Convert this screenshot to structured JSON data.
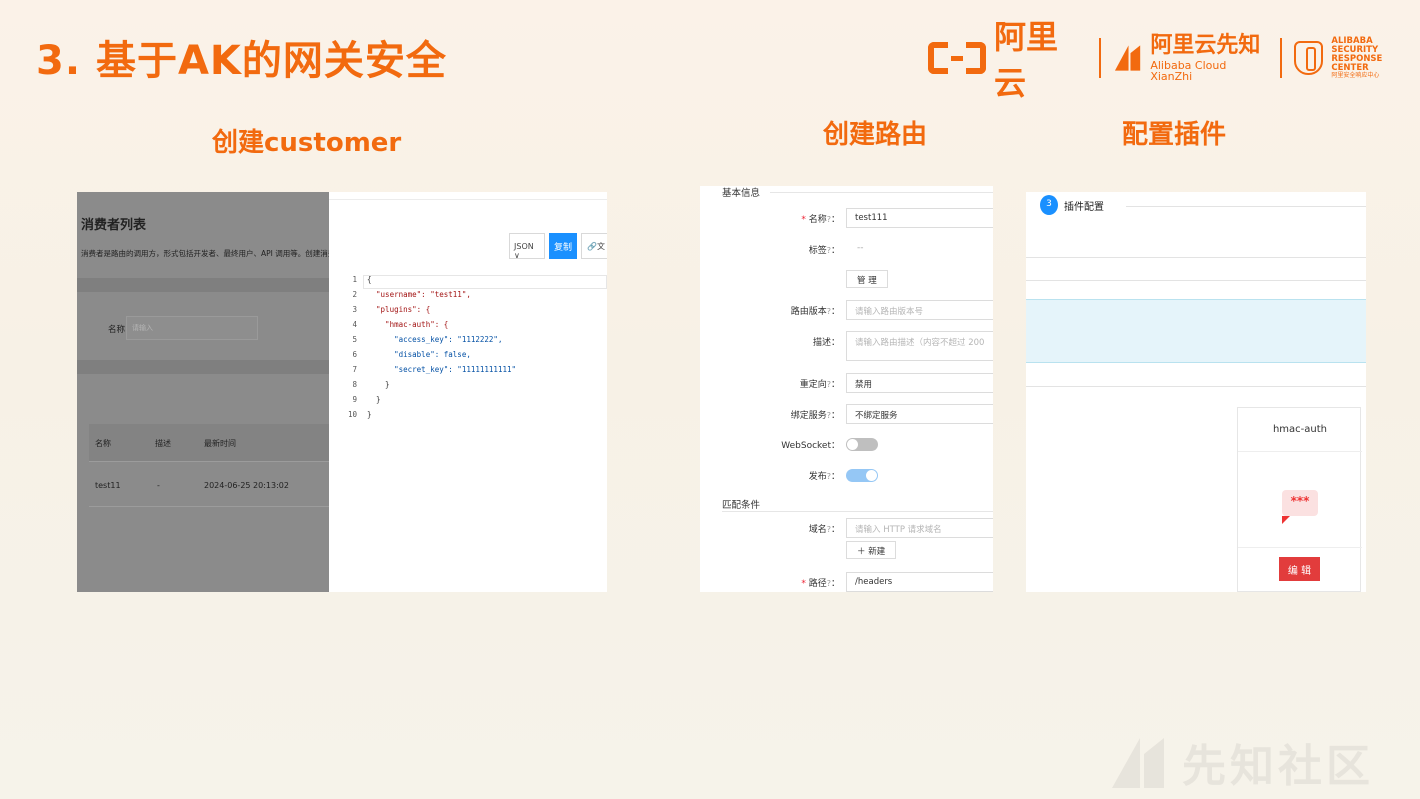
{
  "slide": {
    "title": "3. 基于AK的网关安全"
  },
  "logos": {
    "aliyun": "阿里云",
    "xianzhi_cn": "阿里云先知",
    "xianzhi_en": "Alibaba Cloud XianZhi",
    "asrc_line1": "ALIBABA SECURITY",
    "asrc_line2": "RESPONSE CENTER",
    "asrc_line3": "阿里安全响应中心"
  },
  "headings": {
    "customer": "创建customer",
    "route": "创建路由",
    "plugin": "配置插件"
  },
  "consumer_panel": {
    "title": "消费者列表",
    "description": "消费者是路由的调用方，形式包括开发者、最终用户、API 调用等。创建消费者时，需绑定至",
    "name_label": "名称:",
    "name_placeholder": "请输入",
    "columns": [
      "名称",
      "描述",
      "最新时间"
    ],
    "row": [
      "test11",
      "-",
      "2024-06-25 20:13:02"
    ],
    "format_select": "JSON",
    "copy_button": "复制",
    "doc_button": "文",
    "code_lines": [
      {
        "n": "1",
        "t": "{"
      },
      {
        "n": "2",
        "t": "  \"username\": \"test11\","
      },
      {
        "n": "3",
        "t": "  \"plugins\": {"
      },
      {
        "n": "4",
        "t": "    \"hmac-auth\": {"
      },
      {
        "n": "5",
        "t": "      \"access_key\": \"1112222\","
      },
      {
        "n": "6",
        "t": "      \"disable\": false,"
      },
      {
        "n": "7",
        "t": "      \"secret_key\": \"11111111111\""
      },
      {
        "n": "8",
        "t": "    }"
      },
      {
        "n": "9",
        "t": "  }"
      },
      {
        "n": "10",
        "t": "}"
      }
    ]
  },
  "route_panel": {
    "section_basic": "基本信息",
    "name_label": "名称",
    "name_value": "test111",
    "tags_label": "标签",
    "tags_value": "--",
    "manage_button": "管 理",
    "version_label": "路由版本",
    "version_placeholder": "请输入路由版本号",
    "desc_label": "描述",
    "desc_placeholder": "请输入路由描述（内容不超过 200",
    "redirect_label": "重定向",
    "redirect_value": "禁用",
    "service_label": "绑定服务",
    "service_value": "不绑定服务",
    "websocket_label": "WebSocket",
    "publish_label": "发布",
    "section_match": "匹配条件",
    "host_label": "域名",
    "host_placeholder": "请输入 HTTP 请求域名",
    "new_button": "＋ 新建",
    "path_label": "路径",
    "path_value": "/headers",
    "colon": "：",
    "help": "?"
  },
  "plugin_panel": {
    "step_number": "3",
    "step_title": "插件配置",
    "card_name": "hmac-auth",
    "card_icon_text": "***",
    "edit_button": "编 辑"
  },
  "watermark": {
    "text": "先知社区"
  },
  "colors": {
    "accent": "#f26a0f",
    "primary_blue": "#1a90ff",
    "danger": "#e23c3c"
  }
}
